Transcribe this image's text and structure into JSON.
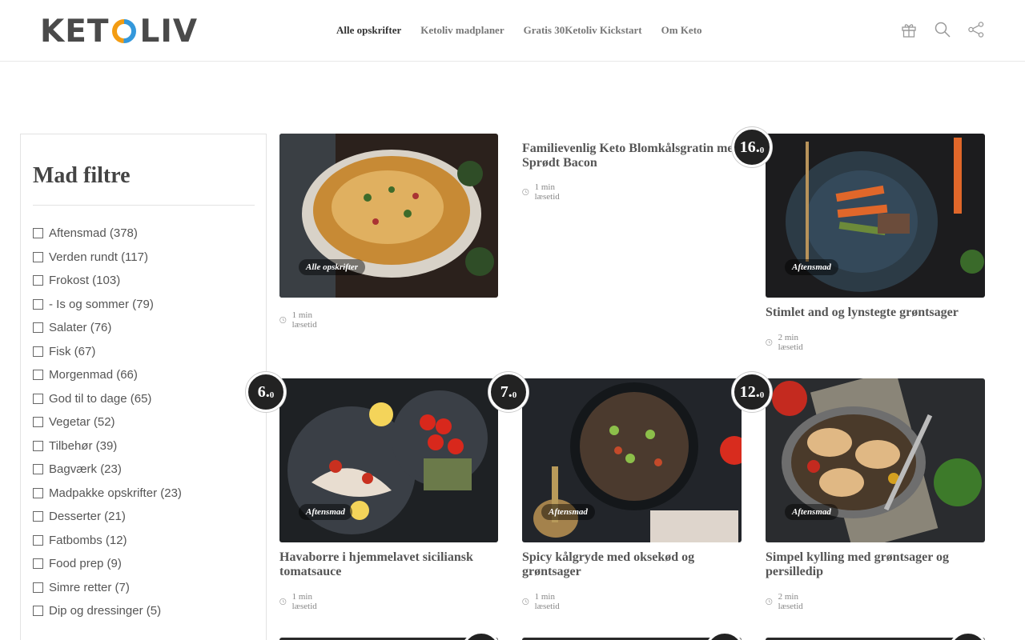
{
  "brand": {
    "logo_left": "KET",
    "logo_right": "LIV"
  },
  "nav": {
    "items": [
      "Alle opskrifter",
      "Ketoliv madplaner",
      "Gratis 30Ketoliv Kickstart",
      "Om Keto"
    ]
  },
  "header_icons": [
    "gift-icon",
    "search-icon",
    "share-icon"
  ],
  "sidebar": {
    "title": "Mad filtre",
    "filters": [
      "Aftensmad (378)",
      "Verden rundt (117)",
      "Frokost (103)",
      "- Is og sommer (79)",
      "Salater (76)",
      "Fisk (67)",
      "Morgenmad (66)",
      "God til to dage (65)",
      "Vegetar (52)",
      "Tilbehør (39)",
      "Bagværk (23)",
      "Madpakke opskrifter (23)",
      "Desserter (21)",
      "Fatbombs (12)",
      "Food prep (9)",
      "Simre retter (7)",
      "Dip og dressinger (5)"
    ]
  },
  "cards": [
    {
      "tag": "Alle opskrifter",
      "title": "",
      "read": "1 min læsetid"
    },
    {
      "tag": "",
      "title": "Familievenlig Keto Blomkålsgratin med Sprødt Bacon",
      "read": "1 min læsetid"
    },
    {
      "tag": "Aftensmad",
      "title": "Stimlet and og lynstegte grøntsager",
      "read": "2 min læsetid",
      "score_main": "16.",
      "score_dec": "0"
    },
    {
      "tag": "Aftensmad",
      "title": "Havaborre i hjemmelavet siciliansk tomatsauce",
      "read": "1 min læsetid",
      "score_main": "6.",
      "score_dec": "0"
    },
    {
      "tag": "Aftensmad",
      "title": "Spicy kålgryde med oksekød og grøntsager",
      "read": "1 min læsetid",
      "score_main": "7.",
      "score_dec": "0"
    },
    {
      "tag": "Aftensmad",
      "title": "Simpel kylling med grøntsager og persilledip",
      "read": "2 min læsetid",
      "score_main": "12.",
      "score_dec": "0"
    }
  ],
  "colors": {
    "accent_orange": "#f39c12",
    "accent_blue": "#3498db",
    "text": "#555555"
  }
}
